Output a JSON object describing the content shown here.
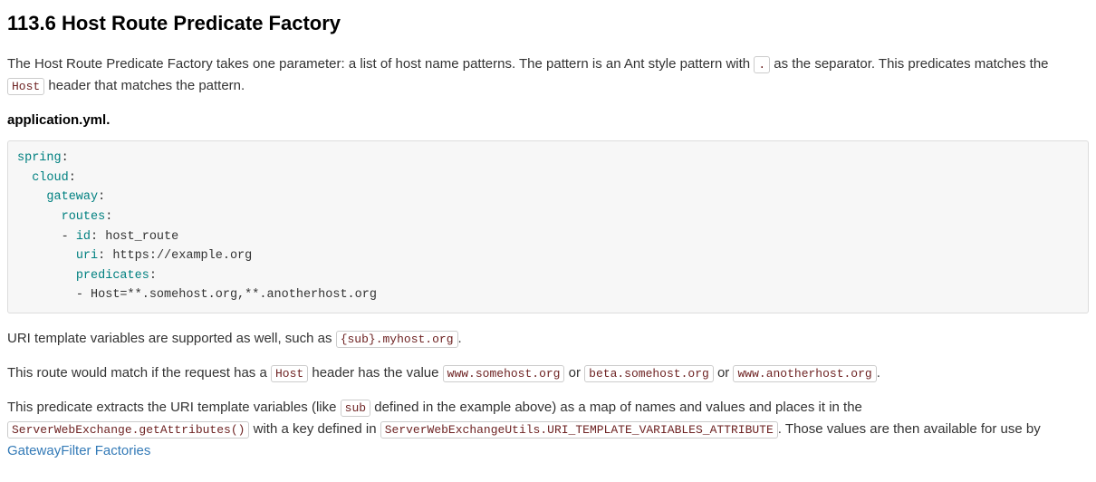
{
  "heading": "113.6 Host Route Predicate Factory",
  "intro": {
    "part1": "The Host Route Predicate Factory takes one parameter: a list of host name patterns. The pattern is an Ant style pattern with ",
    "dot": ".",
    "part2": " as the separator. This predicates matches the ",
    "host": "Host",
    "part3": " header that matches the pattern."
  },
  "filename": "application.yml.",
  "code": {
    "k_spring": "spring",
    "k_cloud": "cloud",
    "k_gateway": "gateway",
    "k_routes": "routes",
    "k_id": "id",
    "v_id": " host_route",
    "k_uri": "uri",
    "v_uri": " https://example.org",
    "k_predicates": "predicates",
    "v_hostline": "- Host=**.somehost.org,**.anotherhost.org"
  },
  "uri_tmpl": {
    "part1": "URI template variables are supported as well, such as ",
    "code": "{sub}.myhost.org",
    "part2": "."
  },
  "route_match": {
    "part1": "This route would match if the request has a ",
    "host": "Host",
    "part2": " header has the value ",
    "v1": "www.somehost.org",
    "or1": " or ",
    "v2": "beta.somehost.org",
    "or2": " or ",
    "v3": "www.anotherhost.org",
    "end": "."
  },
  "extract": {
    "part1": "This predicate extracts the URI template variables (like ",
    "sub": "sub",
    "part2": " defined in the example above) as a map of names and values and places it in the ",
    "attr": "ServerWebExchange.getAttributes()",
    "part3": " with a key defined in ",
    "key": "ServerWebExchangeUtils.URI_TEMPLATE_VARIABLES_ATTRIBUTE",
    "part4": ". Those values are then available for use by ",
    "link": "GatewayFilter Factories"
  }
}
